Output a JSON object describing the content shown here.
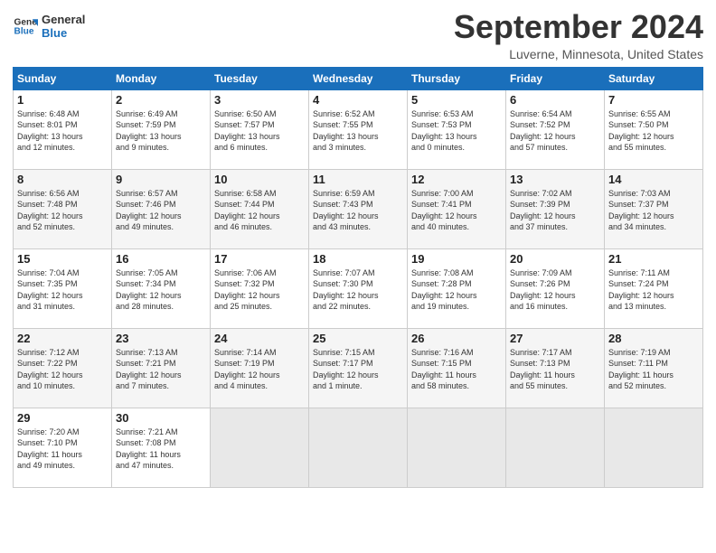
{
  "logo": {
    "line1": "General",
    "line2": "Blue"
  },
  "title": "September 2024",
  "location": "Luverne, Minnesota, United States",
  "days_of_week": [
    "Sunday",
    "Monday",
    "Tuesday",
    "Wednesday",
    "Thursday",
    "Friday",
    "Saturday"
  ],
  "weeks": [
    [
      {
        "day": "1",
        "info": "Sunrise: 6:48 AM\nSunset: 8:01 PM\nDaylight: 13 hours\nand 12 minutes."
      },
      {
        "day": "2",
        "info": "Sunrise: 6:49 AM\nSunset: 7:59 PM\nDaylight: 13 hours\nand 9 minutes."
      },
      {
        "day": "3",
        "info": "Sunrise: 6:50 AM\nSunset: 7:57 PM\nDaylight: 13 hours\nand 6 minutes."
      },
      {
        "day": "4",
        "info": "Sunrise: 6:52 AM\nSunset: 7:55 PM\nDaylight: 13 hours\nand 3 minutes."
      },
      {
        "day": "5",
        "info": "Sunrise: 6:53 AM\nSunset: 7:53 PM\nDaylight: 13 hours\nand 0 minutes."
      },
      {
        "day": "6",
        "info": "Sunrise: 6:54 AM\nSunset: 7:52 PM\nDaylight: 12 hours\nand 57 minutes."
      },
      {
        "day": "7",
        "info": "Sunrise: 6:55 AM\nSunset: 7:50 PM\nDaylight: 12 hours\nand 55 minutes."
      }
    ],
    [
      {
        "day": "8",
        "info": "Sunrise: 6:56 AM\nSunset: 7:48 PM\nDaylight: 12 hours\nand 52 minutes."
      },
      {
        "day": "9",
        "info": "Sunrise: 6:57 AM\nSunset: 7:46 PM\nDaylight: 12 hours\nand 49 minutes."
      },
      {
        "day": "10",
        "info": "Sunrise: 6:58 AM\nSunset: 7:44 PM\nDaylight: 12 hours\nand 46 minutes."
      },
      {
        "day": "11",
        "info": "Sunrise: 6:59 AM\nSunset: 7:43 PM\nDaylight: 12 hours\nand 43 minutes."
      },
      {
        "day": "12",
        "info": "Sunrise: 7:00 AM\nSunset: 7:41 PM\nDaylight: 12 hours\nand 40 minutes."
      },
      {
        "day": "13",
        "info": "Sunrise: 7:02 AM\nSunset: 7:39 PM\nDaylight: 12 hours\nand 37 minutes."
      },
      {
        "day": "14",
        "info": "Sunrise: 7:03 AM\nSunset: 7:37 PM\nDaylight: 12 hours\nand 34 minutes."
      }
    ],
    [
      {
        "day": "15",
        "info": "Sunrise: 7:04 AM\nSunset: 7:35 PM\nDaylight: 12 hours\nand 31 minutes."
      },
      {
        "day": "16",
        "info": "Sunrise: 7:05 AM\nSunset: 7:34 PM\nDaylight: 12 hours\nand 28 minutes."
      },
      {
        "day": "17",
        "info": "Sunrise: 7:06 AM\nSunset: 7:32 PM\nDaylight: 12 hours\nand 25 minutes."
      },
      {
        "day": "18",
        "info": "Sunrise: 7:07 AM\nSunset: 7:30 PM\nDaylight: 12 hours\nand 22 minutes."
      },
      {
        "day": "19",
        "info": "Sunrise: 7:08 AM\nSunset: 7:28 PM\nDaylight: 12 hours\nand 19 minutes."
      },
      {
        "day": "20",
        "info": "Sunrise: 7:09 AM\nSunset: 7:26 PM\nDaylight: 12 hours\nand 16 minutes."
      },
      {
        "day": "21",
        "info": "Sunrise: 7:11 AM\nSunset: 7:24 PM\nDaylight: 12 hours\nand 13 minutes."
      }
    ],
    [
      {
        "day": "22",
        "info": "Sunrise: 7:12 AM\nSunset: 7:22 PM\nDaylight: 12 hours\nand 10 minutes."
      },
      {
        "day": "23",
        "info": "Sunrise: 7:13 AM\nSunset: 7:21 PM\nDaylight: 12 hours\nand 7 minutes."
      },
      {
        "day": "24",
        "info": "Sunrise: 7:14 AM\nSunset: 7:19 PM\nDaylight: 12 hours\nand 4 minutes."
      },
      {
        "day": "25",
        "info": "Sunrise: 7:15 AM\nSunset: 7:17 PM\nDaylight: 12 hours\nand 1 minute."
      },
      {
        "day": "26",
        "info": "Sunrise: 7:16 AM\nSunset: 7:15 PM\nDaylight: 11 hours\nand 58 minutes."
      },
      {
        "day": "27",
        "info": "Sunrise: 7:17 AM\nSunset: 7:13 PM\nDaylight: 11 hours\nand 55 minutes."
      },
      {
        "day": "28",
        "info": "Sunrise: 7:19 AM\nSunset: 7:11 PM\nDaylight: 11 hours\nand 52 minutes."
      }
    ],
    [
      {
        "day": "29",
        "info": "Sunrise: 7:20 AM\nSunset: 7:10 PM\nDaylight: 11 hours\nand 49 minutes."
      },
      {
        "day": "30",
        "info": "Sunrise: 7:21 AM\nSunset: 7:08 PM\nDaylight: 11 hours\nand 47 minutes."
      },
      null,
      null,
      null,
      null,
      null
    ]
  ]
}
